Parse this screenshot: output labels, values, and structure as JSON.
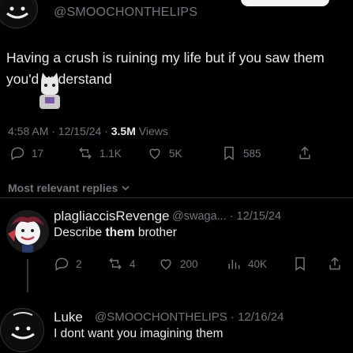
{
  "header": {
    "handle": "@SMOOCHONTHELIPS"
  },
  "post": {
    "text": "Having a crush is ruining my life but if you saw them you'd understand",
    "time_date": "4:58 AM · 12/15/24 · ",
    "views_count": "3.5M",
    "views_label": " Views",
    "stats": {
      "replies": "17",
      "reposts": "1.1K",
      "likes": "5K",
      "bookmarks": "585"
    }
  },
  "sort": {
    "label": "Most relevant replies"
  },
  "replies": [
    {
      "name": "plagliaccisRevenge",
      "handle": "@swaga... · 12/15/24",
      "text_prefix": "Describe ",
      "text_bold": "them",
      "text_suffix": " brother",
      "stats": {
        "replies": "2",
        "reposts": "4",
        "likes": "200",
        "views": "40K"
      }
    },
    {
      "name": "Luke",
      "handle": "@SMOOCHONTHELIPS · 12/16/24",
      "text": "I dont want you imagining them"
    }
  ],
  "colors": {
    "background": "#000000",
    "primary_text": "#e7e9ea",
    "secondary_text": "#71767b",
    "divider": "#2f3336"
  }
}
